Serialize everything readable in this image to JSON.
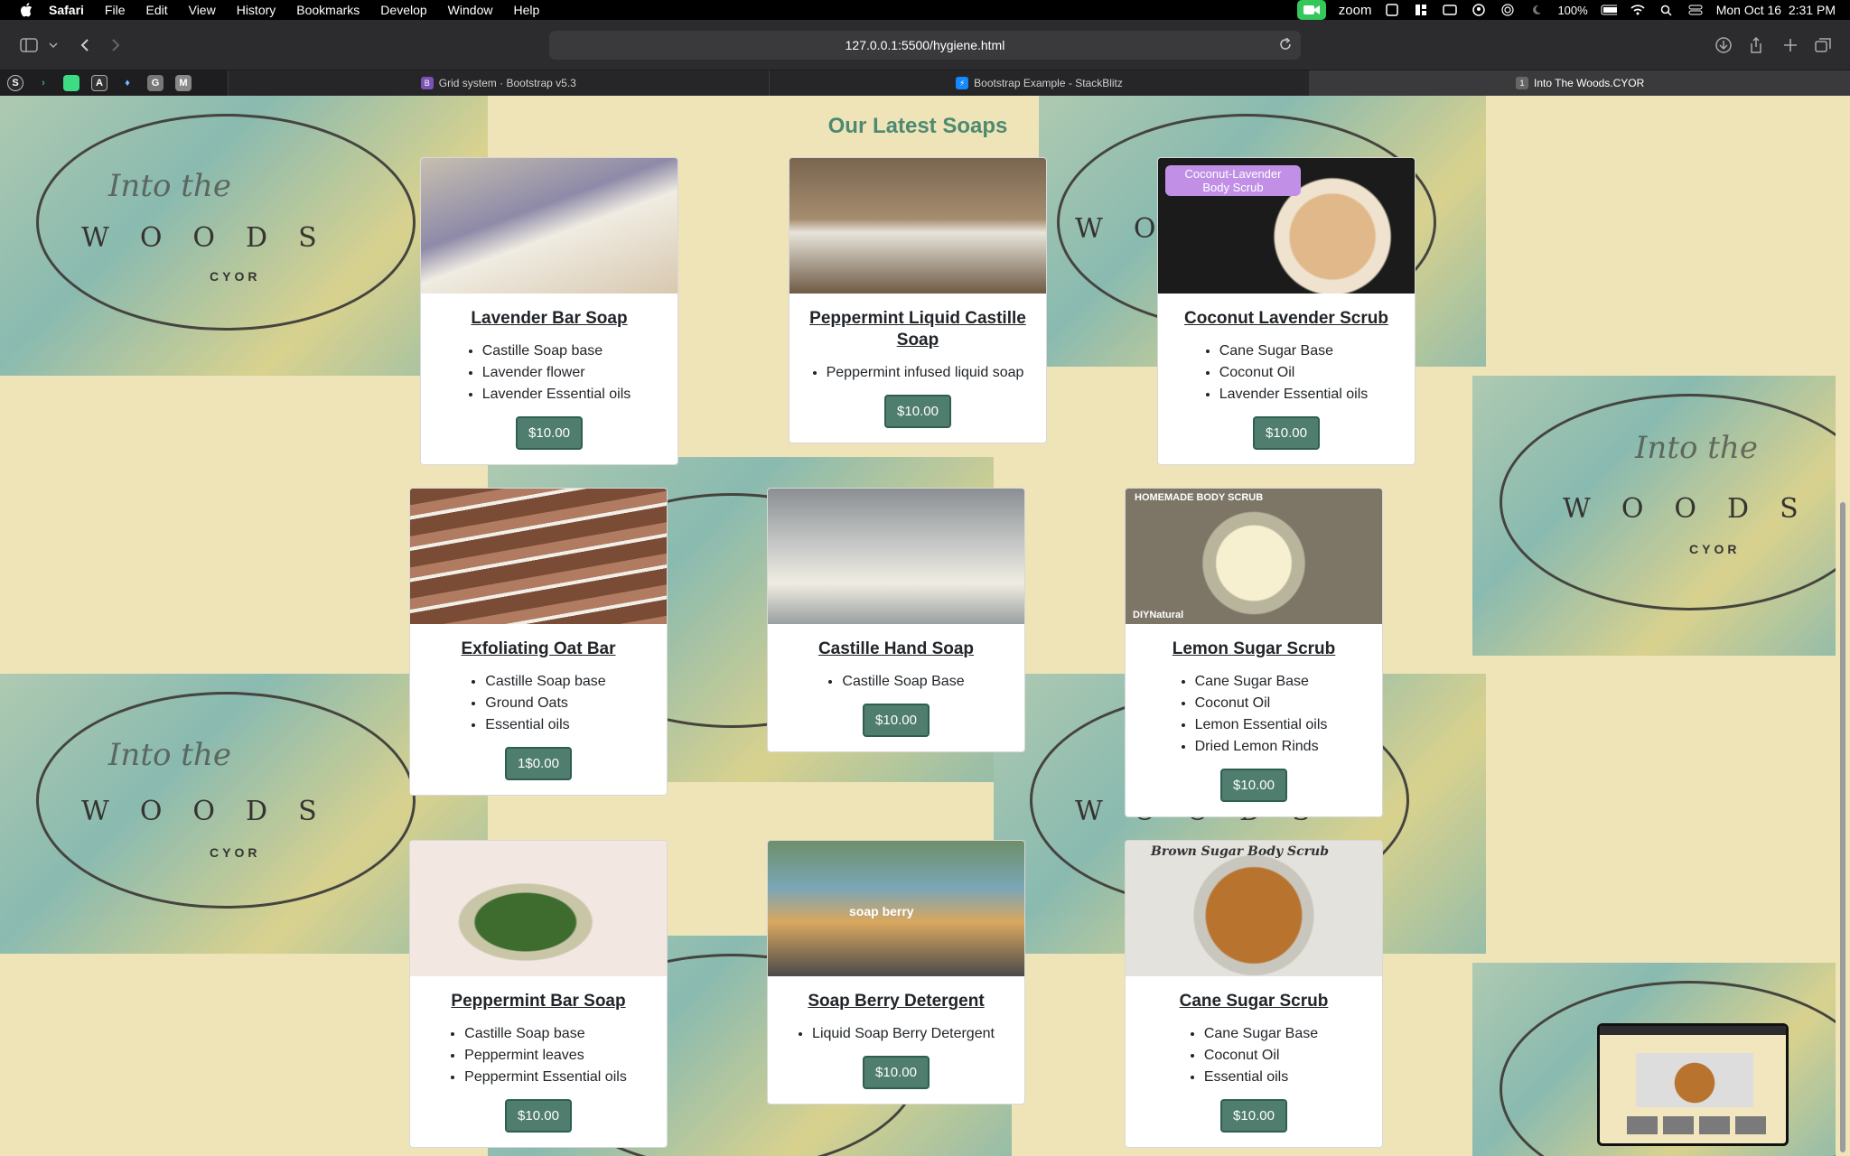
{
  "menubar": {
    "app": "Safari",
    "items": [
      "File",
      "Edit",
      "View",
      "History",
      "Bookmarks",
      "Develop",
      "Window",
      "Help"
    ],
    "zoom": "zoom",
    "battery": "100%",
    "datetime": "Mon Oct 16  2:31 PM"
  },
  "toolbar": {
    "url": "127.0.0.1:5500/hygiene.html"
  },
  "tabs": [
    {
      "label": "Grid system · Bootstrap v5.3",
      "icon": "B",
      "icon_color": "#7952b3"
    },
    {
      "label": "Bootstrap Example - StackBlitz",
      "icon": "⚡",
      "icon_color": "#1389fd"
    },
    {
      "label": "Into The Woods.CYOR",
      "icon": "1",
      "icon_color": "#666666"
    }
  ],
  "page": {
    "heading": "Our Latest Soaps",
    "bg_words": "WOODS",
    "bg_sub": "CYOR"
  },
  "cards": [
    {
      "title": "Lavender Bar Soap",
      "items": [
        "Castille Soap base",
        "Lavender flower",
        "Lavender Essential oils"
      ],
      "price": "$10.00"
    },
    {
      "title": "Peppermint Liquid Castille Soap",
      "items": [
        "Peppermint infused liquid soap"
      ],
      "price": "$10.00"
    },
    {
      "title": "Coconut Lavender Scrub",
      "items": [
        "Cane Sugar Base",
        "Coconut Oil",
        "Lavender Essential oils"
      ],
      "price": "$10.00",
      "image_label": "Coconut-Lavender Body Scrub"
    },
    {
      "title": "Exfoliating Oat Bar",
      "items": [
        "Castille Soap base",
        "Ground Oats",
        "Essential oils"
      ],
      "price": "1$0.00"
    },
    {
      "title": "Castille Hand Soap",
      "items": [
        "Castille Soap Base"
      ],
      "price": "$10.00"
    },
    {
      "title": "Lemon Sugar Scrub",
      "items": [
        "Cane Sugar Base",
        "Coconut Oil",
        "Lemon Essential oils",
        "Dried Lemon Rinds"
      ],
      "price": "$10.00",
      "image_label": "HOMEMADE BODY SCRUB",
      "image_brand": "DIYNatural"
    },
    {
      "title": "Peppermint Bar Soap",
      "items": [
        "Castille Soap base",
        "Peppermint leaves",
        "Peppermint Essential oils"
      ],
      "price": "$10.00"
    },
    {
      "title": "Soap Berry Detergent",
      "items": [
        "Liquid Soap Berry Detergent"
      ],
      "price": "$10.00",
      "image_label": "soap berry"
    },
    {
      "title": "Cane Sugar Scrub",
      "items": [
        "Cane Sugar Base",
        "Coconut Oil",
        "Essential oils"
      ],
      "price": "$10.00",
      "image_label": "Brown Sugar Body Scrub"
    }
  ],
  "colors": {
    "heading": "#4e8a72",
    "price_button": "#4f7d6e",
    "page_bg": "#efe4b8"
  }
}
